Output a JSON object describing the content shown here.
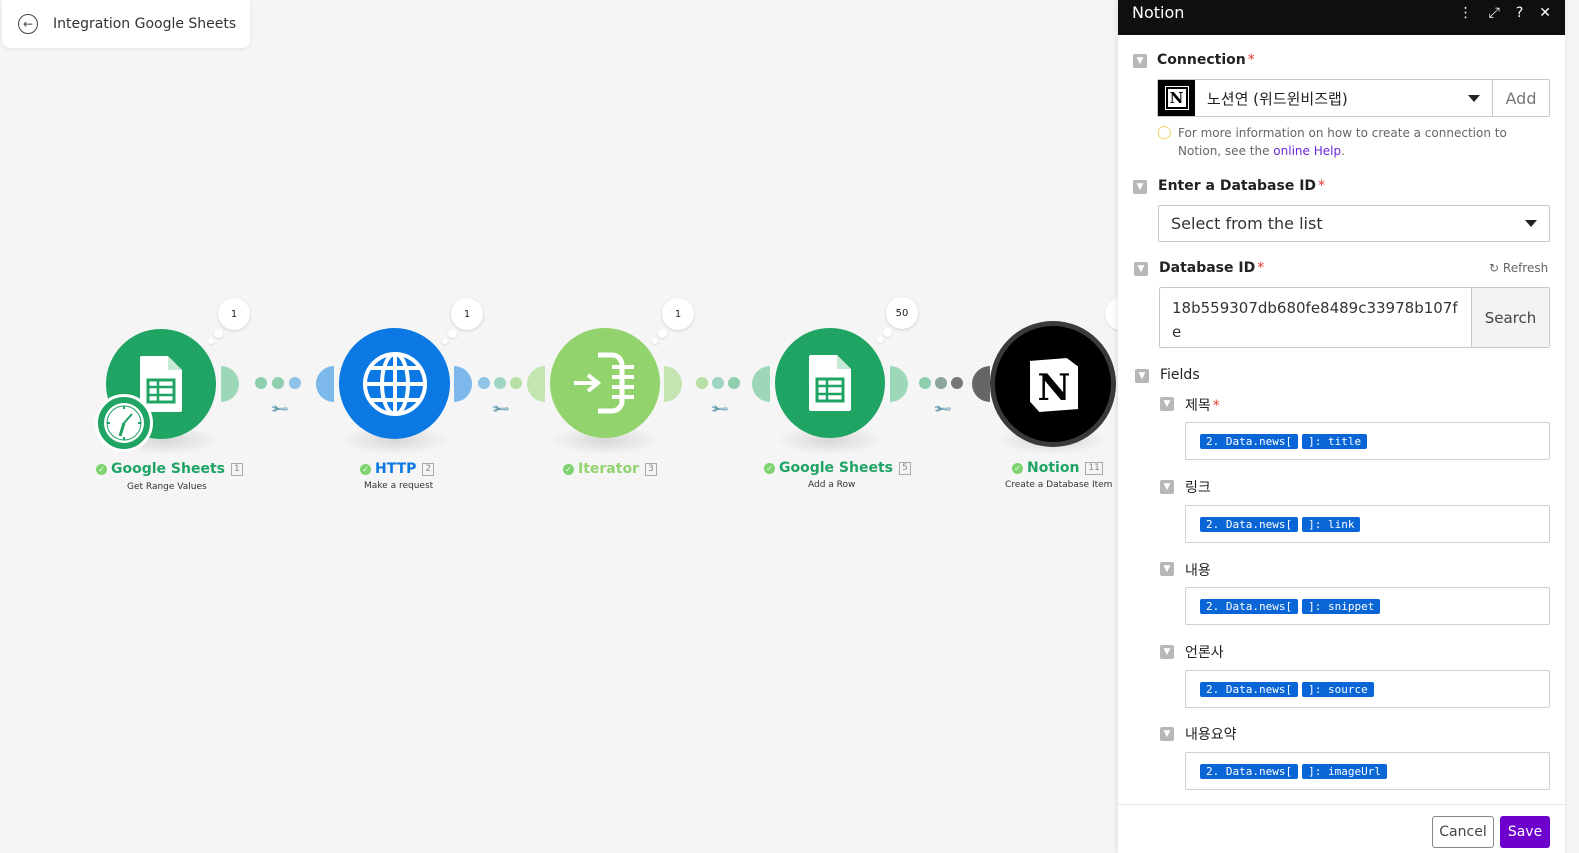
{
  "header": {
    "back_icon": "arrow-left-circle-icon",
    "title": "Integration Google Sheets"
  },
  "modules": [
    {
      "name": "Google Sheets",
      "index": "1",
      "subtitle": "Get Range Values",
      "count": "1",
      "color": "#1fa463"
    },
    {
      "name": "HTTP",
      "index": "2",
      "subtitle": "Make a request",
      "count": "1",
      "color": "#0b78e3"
    },
    {
      "name": "Iterator",
      "index": "3",
      "subtitle": "",
      "count": "1",
      "color": "#92d36e"
    },
    {
      "name": "Google Sheets",
      "index": "5",
      "subtitle": "Add a Row",
      "count": "50",
      "color": "#1fa463"
    },
    {
      "name": "Notion",
      "index": "11",
      "subtitle": "Create a Database Item",
      "count": "",
      "color": "#000000"
    }
  ],
  "panel": {
    "title": "Notion",
    "connection": {
      "label": "Connection",
      "required": "*",
      "value": "노션연 (위드윈비즈랩)",
      "add_label": "Add",
      "help_text": "For more information on how to create a connection to Notion, see the ",
      "help_link": "online Help",
      "help_end": "."
    },
    "database_select": {
      "label": "Enter a Database ID",
      "required": "*",
      "value": "Select from the list"
    },
    "database_id": {
      "label": "Database ID",
      "required": "*",
      "refresh_label": "Refresh",
      "value": "18b559307db680fe8489c33978b107fe",
      "search_label": "Search"
    },
    "fields": {
      "label": "Fields",
      "items": [
        {
          "label": "제목",
          "required": "*",
          "pill1": "2. Data.news[",
          "pill2": "]: title"
        },
        {
          "label": "링크",
          "required": "",
          "pill1": "2. Data.news[",
          "pill2": "]: link"
        },
        {
          "label": "내용",
          "required": "",
          "pill1": "2. Data.news[",
          "pill2": "]: snippet"
        },
        {
          "label": "언론사",
          "required": "",
          "pill1": "2. Data.news[",
          "pill2": "]: source"
        },
        {
          "label": "내용요약",
          "required": "",
          "pill1": "2. Data.news[",
          "pill2": "]: imageUrl"
        }
      ]
    },
    "cancel_label": "Cancel",
    "save_label": "Save",
    "accent": "#6d00cc",
    "pill_color": "#0a66d6"
  }
}
